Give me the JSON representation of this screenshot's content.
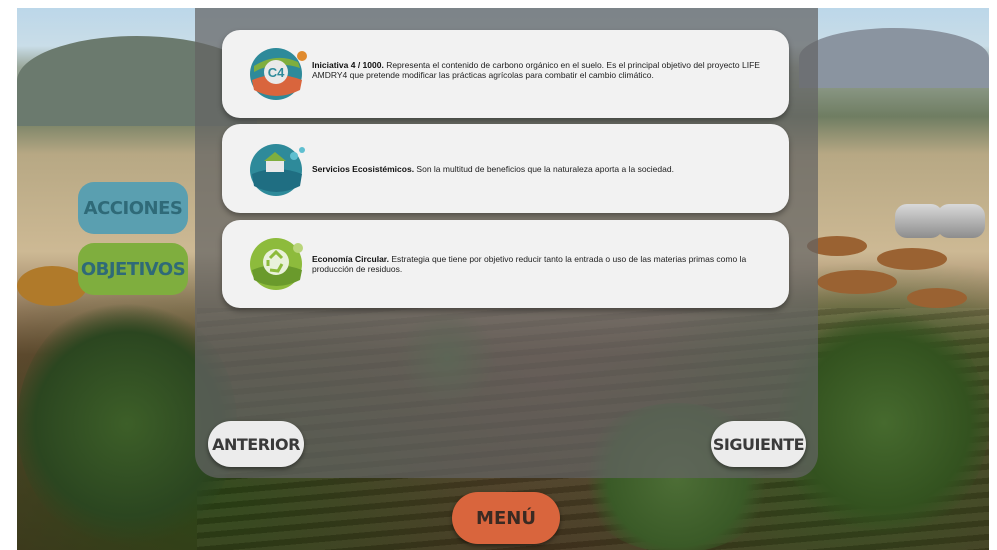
{
  "side_buttons": {
    "acciones": "ACCIONES",
    "objetivos": "OBJETIVOS"
  },
  "cards": [
    {
      "icon": "c4-logo-icon",
      "title": "Iniciativa 4 / 1000.",
      "text": " Representa el contenido de carbono orgánico en el suelo. Es el principal objetivo del proyecto LIFE AMDRY4 que pretende modificar las prácticas agrícolas para combatir el cambio climático."
    },
    {
      "icon": "ecosystem-services-icon",
      "title": "Servicios Ecosistémicos.",
      "text": " Son la multitud de beneficios que la naturaleza aporta a la sociedad."
    },
    {
      "icon": "recycle-icon",
      "title": "Economía Circular.",
      "text": " Estrategia que tiene por objetivo reducir tanto la entrada o uso de las materias primas como la producción de residuos."
    }
  ],
  "nav": {
    "anterior": "ANTERIOR",
    "siguiente": "SIGUIENTE",
    "menu": "MENÚ"
  },
  "colors": {
    "acciones_bg": "#5a9fb0",
    "objetivos_bg": "#7fae3e",
    "menu_bg": "#d9653d",
    "card_bg": "#f2f2f2"
  }
}
